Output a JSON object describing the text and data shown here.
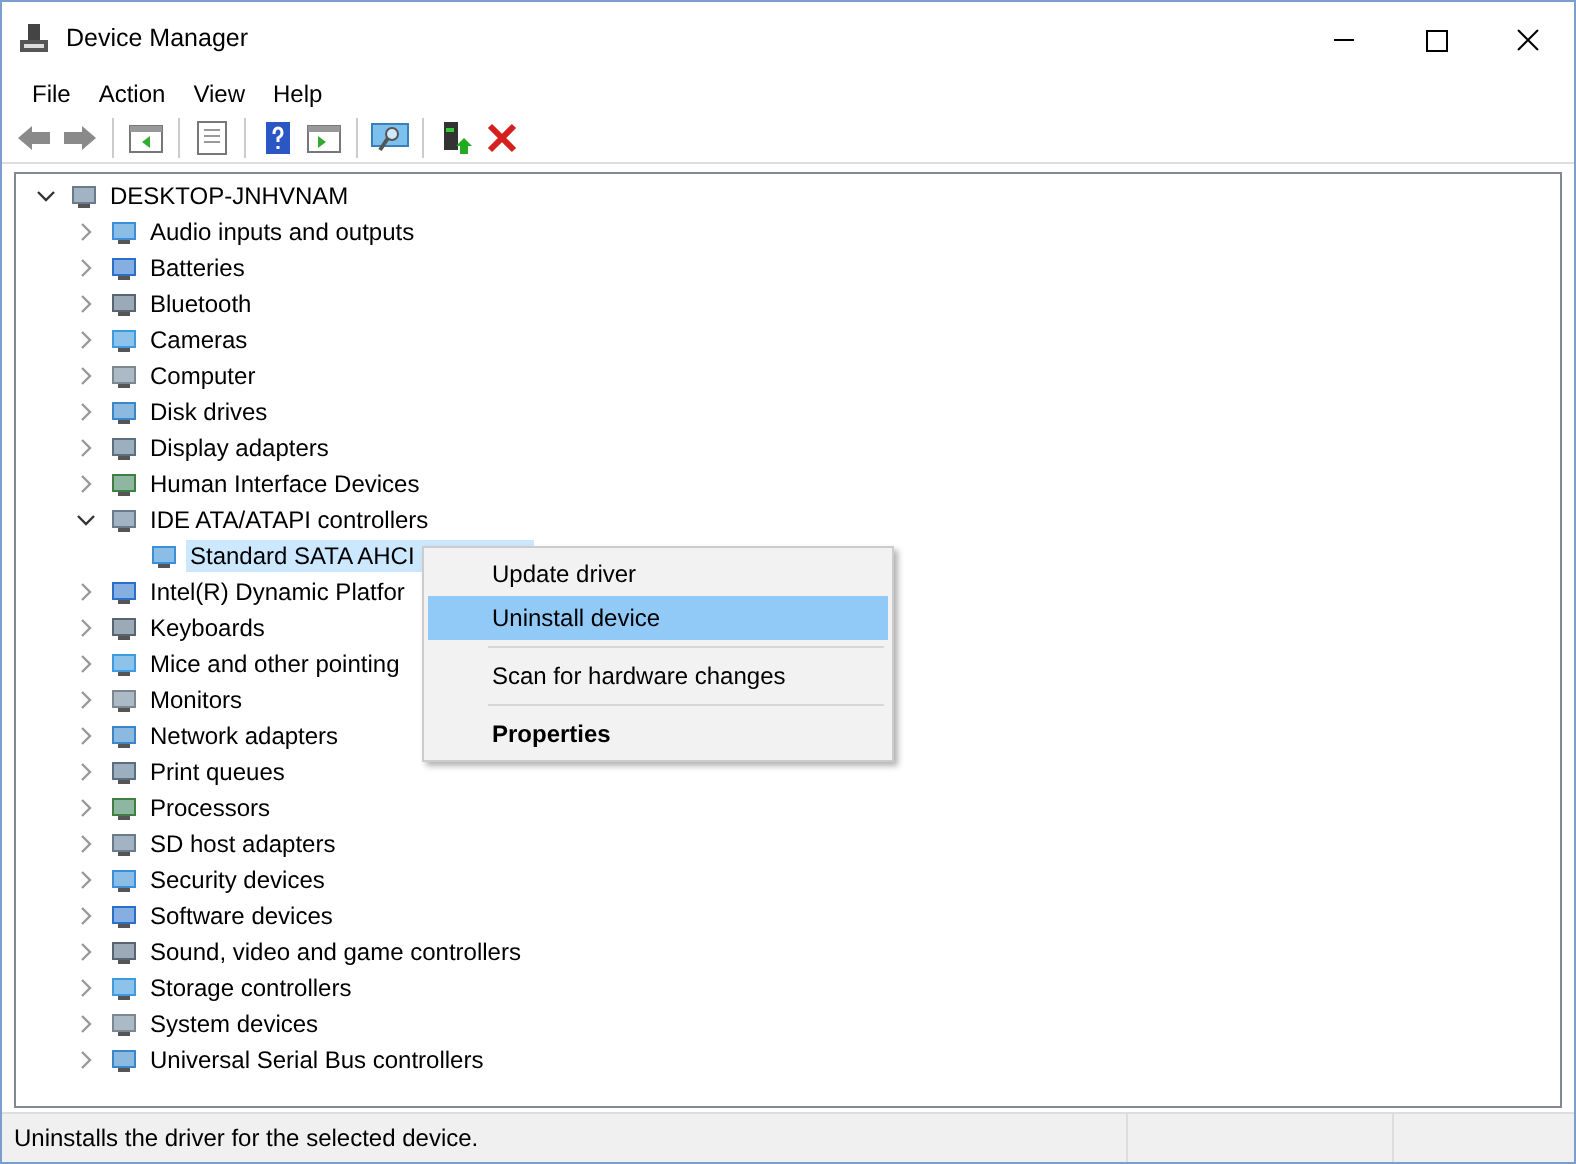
{
  "window": {
    "title": "Device Manager"
  },
  "menu_bar": [
    "File",
    "Action",
    "View",
    "Help"
  ],
  "toolbar": [
    {
      "kind": "back"
    },
    {
      "kind": "forward"
    },
    {
      "kind": "sep"
    },
    {
      "kind": "tree"
    },
    {
      "kind": "sep"
    },
    {
      "kind": "properties"
    },
    {
      "kind": "sep"
    },
    {
      "kind": "help"
    },
    {
      "kind": "pane"
    },
    {
      "kind": "sep"
    },
    {
      "kind": "scan"
    },
    {
      "kind": "sep"
    },
    {
      "kind": "update"
    },
    {
      "kind": "remove"
    }
  ],
  "tree": {
    "label": "DESKTOP-JNHVNAM",
    "expanded": true,
    "selected": false,
    "children": [
      {
        "label": "Audio inputs and outputs",
        "expanded": false,
        "selected": false
      },
      {
        "label": "Batteries",
        "expanded": false,
        "selected": false
      },
      {
        "label": "Bluetooth",
        "expanded": false,
        "selected": false
      },
      {
        "label": "Cameras",
        "expanded": false,
        "selected": false
      },
      {
        "label": "Computer",
        "expanded": false,
        "selected": false
      },
      {
        "label": "Disk drives",
        "expanded": false,
        "selected": false
      },
      {
        "label": "Display adapters",
        "expanded": false,
        "selected": false
      },
      {
        "label": "Human Interface Devices",
        "expanded": false,
        "selected": false
      },
      {
        "label": "IDE ATA/ATAPI controllers",
        "expanded": true,
        "selected": false,
        "children": [
          {
            "label": "Standard SATA AHCI",
            "selected": true
          }
        ]
      },
      {
        "label": "Intel(R) Dynamic Platfor",
        "expanded": false,
        "selected": false
      },
      {
        "label": "Keyboards",
        "expanded": false,
        "selected": false
      },
      {
        "label": "Mice and other pointing",
        "expanded": false,
        "selected": false
      },
      {
        "label": "Monitors",
        "expanded": false,
        "selected": false
      },
      {
        "label": "Network adapters",
        "expanded": false,
        "selected": false
      },
      {
        "label": "Print queues",
        "expanded": false,
        "selected": false
      },
      {
        "label": "Processors",
        "expanded": false,
        "selected": false
      },
      {
        "label": "SD host adapters",
        "expanded": false,
        "selected": false
      },
      {
        "label": "Security devices",
        "expanded": false,
        "selected": false
      },
      {
        "label": "Software devices",
        "expanded": false,
        "selected": false
      },
      {
        "label": "Sound, video and game controllers",
        "expanded": false,
        "selected": false
      },
      {
        "label": "Storage controllers",
        "expanded": false,
        "selected": false
      },
      {
        "label": "System devices",
        "expanded": false,
        "selected": false
      },
      {
        "label": "Universal Serial Bus controllers",
        "expanded": false,
        "selected": false
      }
    ]
  },
  "context_menu": [
    [
      {
        "label": "Update driver",
        "selected": false,
        "bold": false
      },
      {
        "label": "Uninstall device",
        "selected": true,
        "bold": false
      }
    ],
    [
      {
        "label": "Scan for hardware changes",
        "selected": false,
        "bold": false
      }
    ],
    [
      {
        "label": "Properties",
        "selected": false,
        "bold": true
      }
    ]
  ],
  "status_bar": "Uninstalls the driver for the selected device."
}
